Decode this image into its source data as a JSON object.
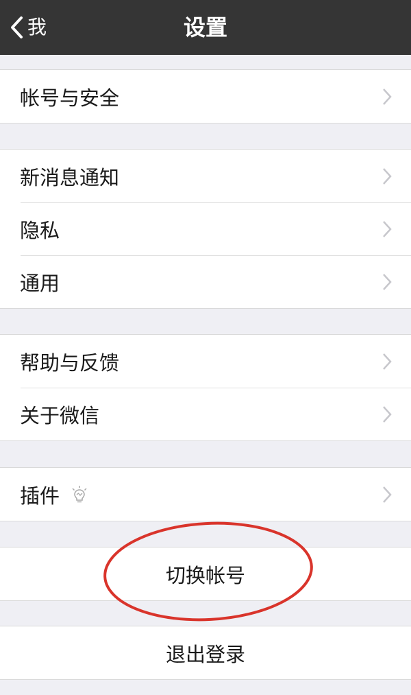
{
  "navbar": {
    "back_label": "我",
    "title": "设置"
  },
  "groups": [
    {
      "items": [
        {
          "label": "帐号与安全"
        }
      ]
    },
    {
      "items": [
        {
          "label": "新消息通知"
        },
        {
          "label": "隐私"
        },
        {
          "label": "通用"
        }
      ]
    },
    {
      "items": [
        {
          "label": "帮助与反馈"
        },
        {
          "label": "关于微信"
        }
      ]
    },
    {
      "items": [
        {
          "label": "插件",
          "icon": "lightbulb-icon"
        }
      ]
    }
  ],
  "actions": {
    "switch_account": "切换帐号",
    "logout": "退出登录"
  },
  "colors": {
    "navbar_bg": "#353535",
    "page_bg": "#efeff4",
    "annotation_red": "#d9342b"
  }
}
